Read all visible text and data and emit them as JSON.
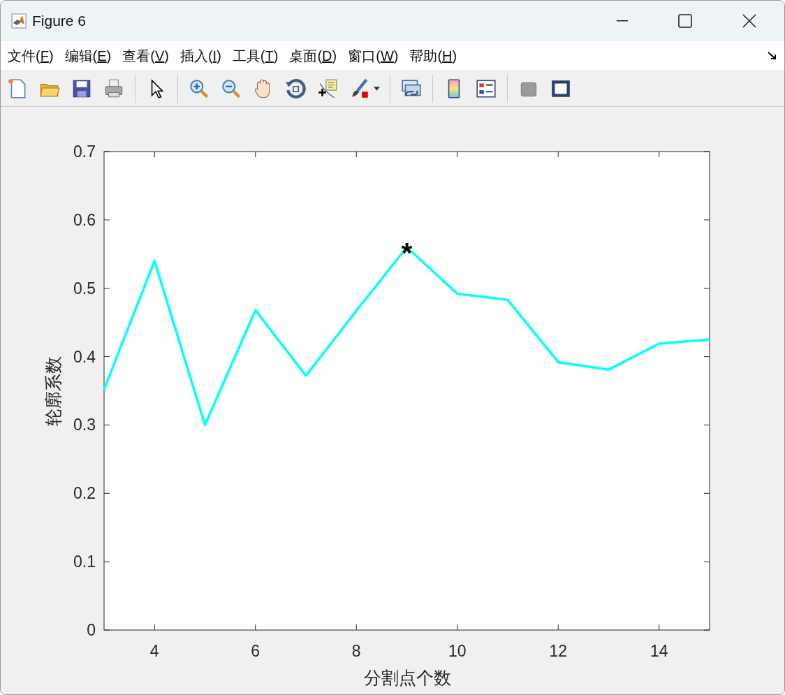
{
  "window": {
    "title": "Figure 6"
  },
  "menu": [
    {
      "before": "文件(",
      "key": "F",
      "after": ")"
    },
    {
      "before": "编辑(",
      "key": "E",
      "after": ")"
    },
    {
      "before": "查看(",
      "key": "V",
      "after": ")"
    },
    {
      "before": "插入(",
      "key": "I",
      "after": ")"
    },
    {
      "before": "工具(",
      "key": "T",
      "after": ")"
    },
    {
      "before": "桌面(",
      "key": "D",
      "after": ")"
    },
    {
      "before": "窗口(",
      "key": "W",
      "after": ")"
    },
    {
      "before": "帮助(",
      "key": "H",
      "after": ")"
    }
  ],
  "toolbar": [
    {
      "kind": "new"
    },
    {
      "kind": "open"
    },
    {
      "kind": "save"
    },
    {
      "kind": "print"
    },
    {
      "kind": "sep"
    },
    {
      "kind": "pointer"
    },
    {
      "kind": "sep"
    },
    {
      "kind": "zoomin"
    },
    {
      "kind": "zoomout"
    },
    {
      "kind": "pan"
    },
    {
      "kind": "rotate"
    },
    {
      "kind": "cursor"
    },
    {
      "kind": "brush"
    },
    {
      "kind": "caret"
    },
    {
      "kind": "sep"
    },
    {
      "kind": "link"
    },
    {
      "kind": "sep"
    },
    {
      "kind": "colorbar"
    },
    {
      "kind": "legend"
    },
    {
      "kind": "sep"
    },
    {
      "kind": "hide"
    },
    {
      "kind": "tools"
    }
  ],
  "figure": {
    "chart_data": {
      "type": "line",
      "xlabel": "分割点个数",
      "ylabel": "轮廓系数",
      "x": [
        3,
        4,
        5,
        6,
        7,
        8,
        9,
        10,
        11,
        12,
        13,
        14,
        15
      ],
      "series": [
        {
          "color": "#00ffff",
          "values": [
            0.352,
            0.54,
            0.3,
            0.468,
            0.372,
            0.467,
            0.56,
            0.492,
            0.483,
            0.392,
            0.381,
            0.419,
            0.425
          ]
        }
      ],
      "xlim": [
        3,
        15
      ],
      "ylim": [
        0,
        0.7
      ],
      "xticks": [
        4,
        6,
        8,
        10,
        12,
        14
      ],
      "yticks": [
        {
          "value": 0,
          "label": "0"
        },
        {
          "value": 0.1,
          "label": "0.1"
        },
        {
          "value": 0.2,
          "label": "0.2"
        },
        {
          "value": 0.3,
          "label": "0.3"
        },
        {
          "value": 0.4,
          "label": "0.4"
        },
        {
          "value": 0.5,
          "label": "0.5"
        },
        {
          "value": 0.6,
          "label": "0.6"
        },
        {
          "value": 0.7,
          "label": "0.7"
        }
      ],
      "annotations": [
        {
          "text": "*",
          "x": 9,
          "y": 0.56
        }
      ]
    }
  }
}
